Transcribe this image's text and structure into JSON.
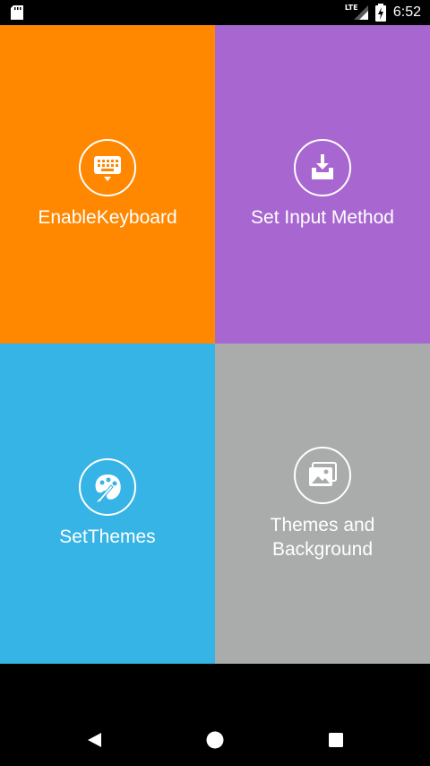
{
  "status_bar": {
    "time": "6:52",
    "network": "LTE"
  },
  "tiles": [
    {
      "label": "EnableKeyboard",
      "icon": "keyboard-icon",
      "color": "#ff8800"
    },
    {
      "label": "Set Input Method",
      "icon": "download-tray-icon",
      "color": "#a866d0"
    },
    {
      "label": "SetThemes",
      "icon": "palette-icon",
      "color": "#36b4e5"
    },
    {
      "label_line1": "Themes and",
      "label_line2": "Background",
      "icon": "images-icon",
      "color": "#aaabab"
    }
  ],
  "nav_bar": {
    "back_icon": "back-triangle-icon",
    "home_icon": "home-circle-icon",
    "recent_icon": "recent-square-icon"
  }
}
